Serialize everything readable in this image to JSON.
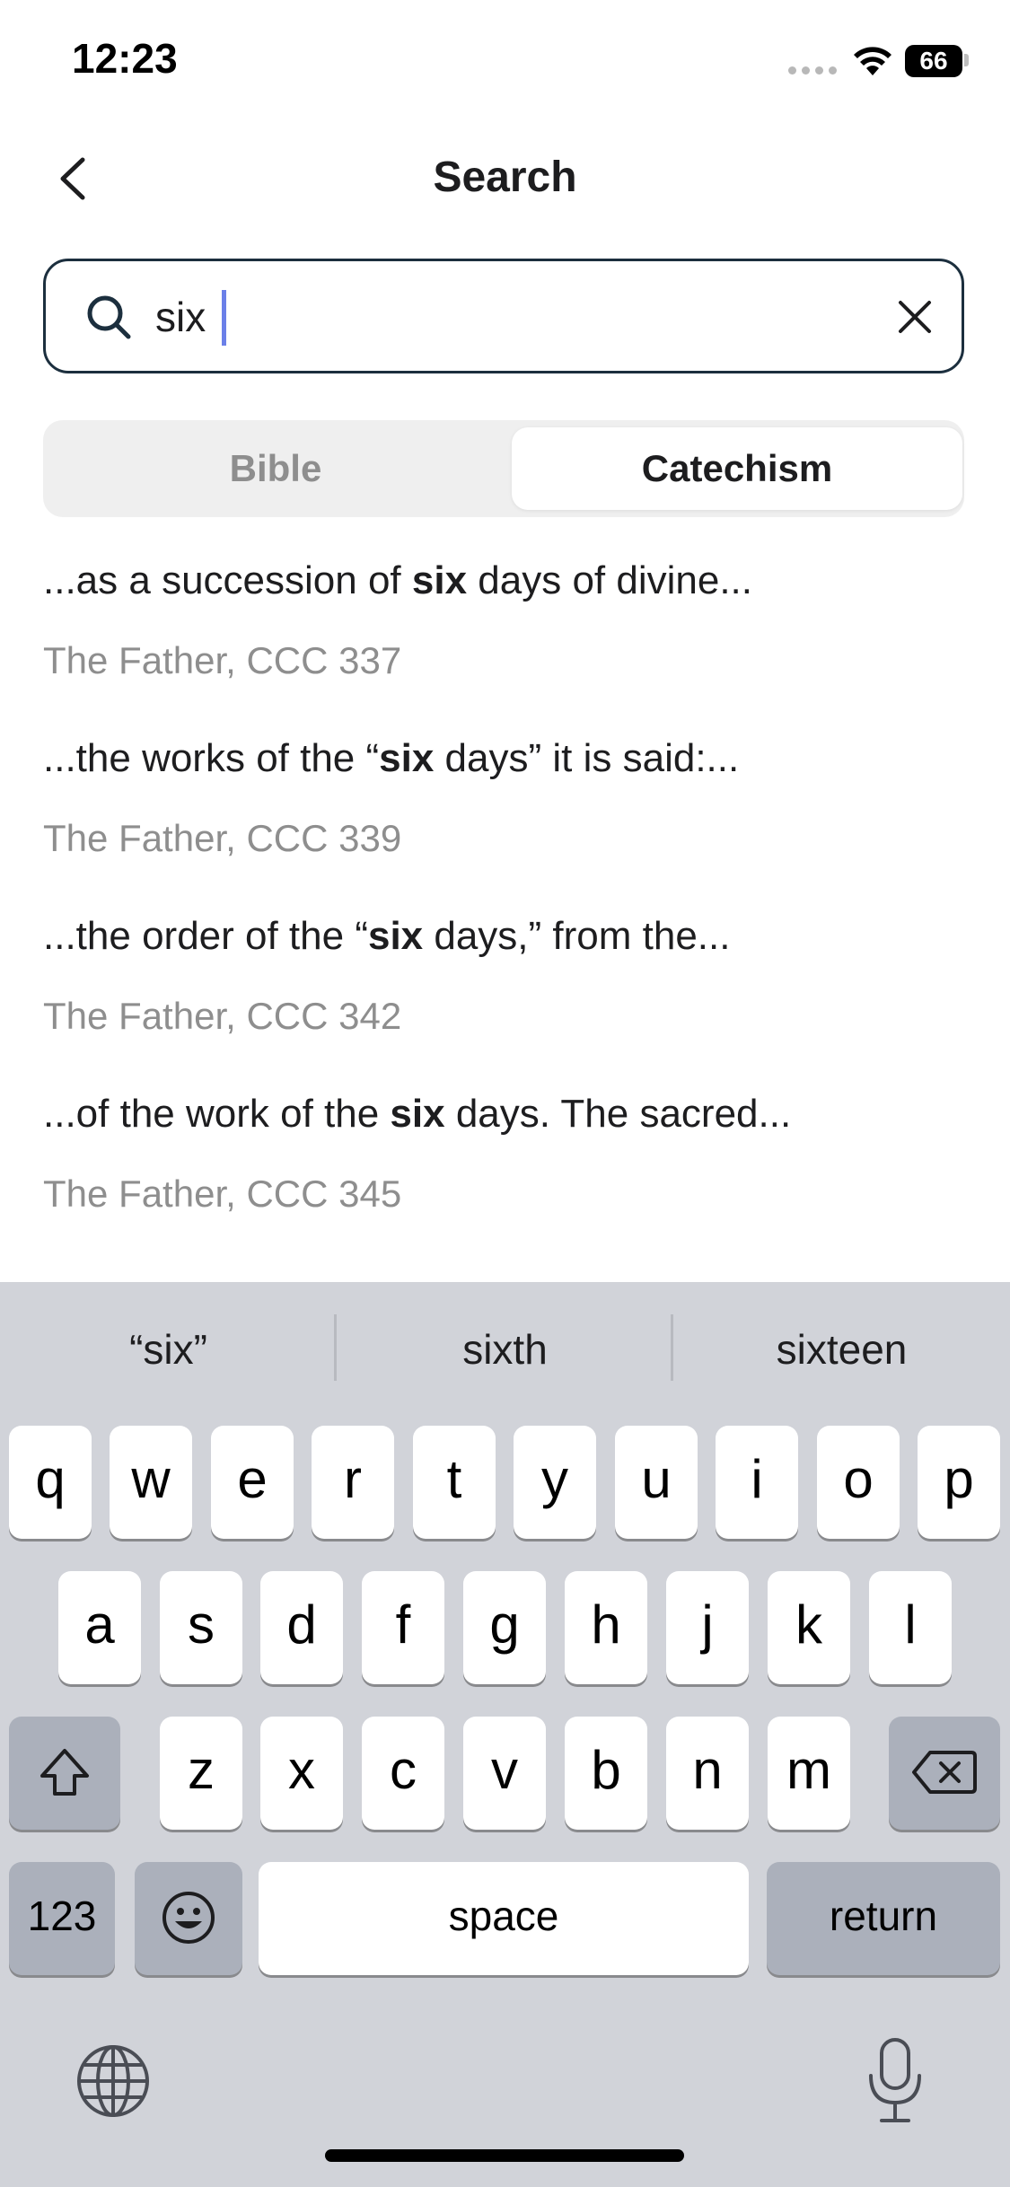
{
  "status": {
    "time": "12:23",
    "battery": "66"
  },
  "nav": {
    "title": "Search"
  },
  "search": {
    "value": "six",
    "placeholder": ""
  },
  "segments": {
    "bible": "Bible",
    "catechism": "Catechism",
    "selected": "Catechism"
  },
  "results": [
    {
      "before": "...as a succession of ",
      "term": "six",
      "after": " days of divine...",
      "source": "The Father, CCC 337"
    },
    {
      "before": "...the works of the “",
      "term": "six",
      "after": " days” it is said:...",
      "source": "The Father, CCC 339"
    },
    {
      "before": "...the order of the “",
      "term": "six",
      "after": " days,” from the...",
      "source": "The Father, CCC 342"
    },
    {
      "before": "...of the work of the ",
      "term": "six",
      "after": " days. The sacred...",
      "source": "The Father, CCC 345"
    }
  ],
  "keyboard": {
    "suggestions": [
      "“six”",
      "sixth",
      "sixteen"
    ],
    "row1": [
      "q",
      "w",
      "e",
      "r",
      "t",
      "y",
      "u",
      "i",
      "o",
      "p"
    ],
    "row2": [
      "a",
      "s",
      "d",
      "f",
      "g",
      "h",
      "j",
      "k",
      "l"
    ],
    "row3": [
      "z",
      "x",
      "c",
      "v",
      "b",
      "n",
      "m"
    ],
    "numbers": "123",
    "space": "space",
    "return": "return",
    "icons": {
      "shift": "shift-icon",
      "delete": "delete-icon",
      "emoji": "emoji-icon",
      "globe": "globe-icon",
      "mic": "microphone-icon"
    }
  }
}
